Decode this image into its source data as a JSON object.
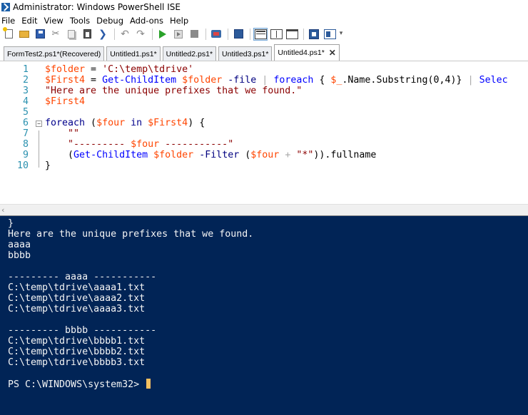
{
  "window": {
    "title": "Administrator: Windows PowerShell ISE"
  },
  "menu": [
    "File",
    "Edit",
    "View",
    "Tools",
    "Debug",
    "Add-ons",
    "Help"
  ],
  "toolbar": {
    "icons": [
      "new-script-icon",
      "open-icon",
      "save-icon",
      "cut-icon",
      "copy-icon",
      "paste-icon",
      "powershell-icon",
      "undo-icon",
      "redo-icon",
      "run-script-icon",
      "run-selection-icon",
      "stop-icon",
      "remote-powershell-icon",
      "start-powershell-icon",
      "show-script-pane-top-icon",
      "show-script-pane-right-icon",
      "show-script-pane-maximized-icon",
      "show-command-window-icon",
      "show-command-addon-icon"
    ]
  },
  "tabs": [
    {
      "label": "FormTest2.ps1*(Recovered)",
      "active": false
    },
    {
      "label": "Untitled1.ps1*",
      "active": false
    },
    {
      "label": "Untitled2.ps1*",
      "active": false
    },
    {
      "label": "Untitled3.ps1*",
      "active": false
    },
    {
      "label": "Untitled4.ps1*",
      "active": true,
      "close": "✕"
    }
  ],
  "script": {
    "lines": [
      {
        "num": "1",
        "tokens": [
          [
            "var",
            "$folder"
          ],
          [
            "pl",
            " = "
          ],
          [
            "str",
            "'C:\\temp\\tdrive'"
          ]
        ]
      },
      {
        "num": "2",
        "tokens": [
          [
            "var",
            "$First4"
          ],
          [
            "pl",
            " = "
          ],
          [
            "cmd",
            "Get-ChildItem"
          ],
          [
            "pl",
            " "
          ],
          [
            "var",
            "$folder"
          ],
          [
            "pl",
            " "
          ],
          [
            "param",
            "-file"
          ],
          [
            "pl",
            " "
          ],
          [
            "op",
            "|"
          ],
          [
            "pl",
            " "
          ],
          [
            "cmd",
            "foreach"
          ],
          [
            "pl",
            " { "
          ],
          [
            "var",
            "$_"
          ],
          [
            "pl",
            ".Name.Substring("
          ],
          [
            "num",
            "0"
          ],
          [
            "pl",
            ","
          ],
          [
            "num",
            "4"
          ],
          [
            "pl",
            ")} "
          ],
          [
            "op",
            "|"
          ],
          [
            "pl",
            " "
          ],
          [
            "cmd",
            "Selec"
          ]
        ]
      },
      {
        "num": "3",
        "tokens": [
          [
            "str",
            "\"Here are the unique prefixes that we found.\""
          ]
        ]
      },
      {
        "num": "4",
        "tokens": [
          [
            "var",
            "$First4"
          ]
        ]
      },
      {
        "num": "5",
        "tokens": []
      },
      {
        "num": "6",
        "tokens": [
          [
            "kw",
            "foreach"
          ],
          [
            "pl",
            " ("
          ],
          [
            "var",
            "$four"
          ],
          [
            "pl",
            " "
          ],
          [
            "kw",
            "in"
          ],
          [
            "pl",
            " "
          ],
          [
            "var",
            "$First4"
          ],
          [
            "pl",
            ") {"
          ]
        ]
      },
      {
        "num": "7",
        "tokens": [
          [
            "pl",
            "    "
          ],
          [
            "str",
            "\"\""
          ]
        ]
      },
      {
        "num": "8",
        "tokens": [
          [
            "pl",
            "    "
          ],
          [
            "str",
            "\"--------- "
          ],
          [
            "var",
            "$four"
          ],
          [
            "str",
            " -----------\""
          ]
        ]
      },
      {
        "num": "9",
        "tokens": [
          [
            "pl",
            "    "
          ],
          [
            "pl",
            "("
          ],
          [
            "cmd",
            "Get-ChildItem"
          ],
          [
            "pl",
            " "
          ],
          [
            "var",
            "$folder"
          ],
          [
            "pl",
            " "
          ],
          [
            "param",
            "-Filter"
          ],
          [
            "pl",
            " ("
          ],
          [
            "var",
            "$four"
          ],
          [
            "pl",
            " "
          ],
          [
            "op",
            "+"
          ],
          [
            "pl",
            " "
          ],
          [
            "str",
            "\"*\""
          ],
          [
            "pl",
            "))"
          ],
          [
            "pl",
            ".fullname"
          ]
        ]
      },
      {
        "num": "10",
        "tokens": [
          [
            "pl",
            "}"
          ]
        ]
      }
    ]
  },
  "console": {
    "lines": [
      "}",
      "Here are the unique prefixes that we found.",
      "aaaa",
      "bbbb",
      "",
      "--------- aaaa -----------",
      "C:\\temp\\tdrive\\aaaa1.txt",
      "C:\\temp\\tdrive\\aaaa2.txt",
      "C:\\temp\\tdrive\\aaaa3.txt",
      "",
      "--------- bbbb -----------",
      "C:\\temp\\tdrive\\bbbb1.txt",
      "C:\\temp\\tdrive\\bbbb2.txt",
      "C:\\temp\\tdrive\\bbbb3.txt",
      "",
      "PS C:\\WINDOWS\\system32> "
    ]
  },
  "colors": {
    "console_bg": "#012456",
    "console_fg": "#f5f5f5",
    "line_number": "#2b91af",
    "variable": "#ff4500",
    "string": "#8b0000",
    "command": "#0000ff",
    "keyword": "#00008b"
  }
}
